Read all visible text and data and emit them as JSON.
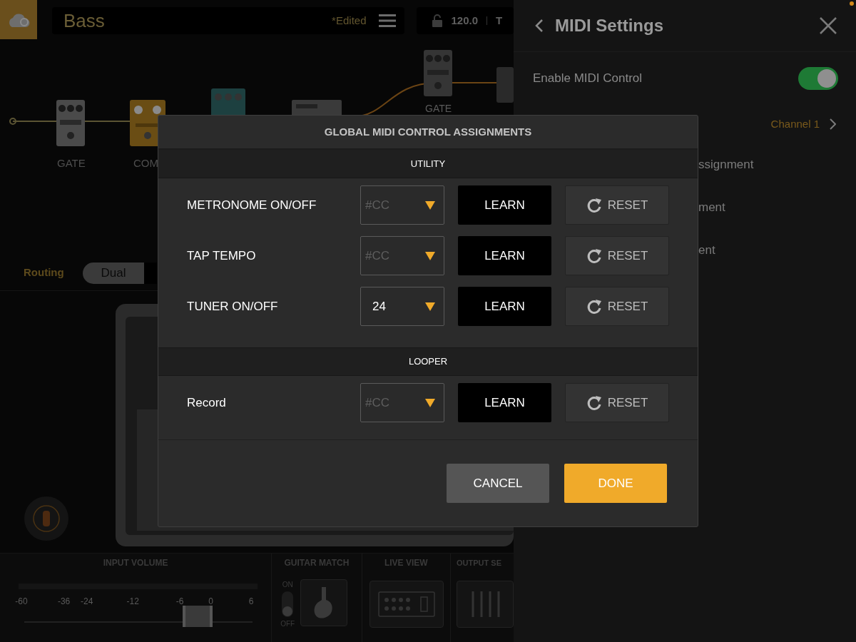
{
  "top_bar": {
    "preset_name": "Bass",
    "edited": "*Edited",
    "tempo": "120.0",
    "tap": "T"
  },
  "chain": [
    {
      "label": "GATE"
    },
    {
      "label": "COM"
    }
  ],
  "upper_chain": [
    {
      "label": "GATE"
    }
  ],
  "routing": {
    "label": "Routing",
    "option": "Dual"
  },
  "bottom": {
    "input_volume": {
      "title": "INPUT VOLUME",
      "ticks": [
        "-60",
        "-36",
        "-24",
        "-12",
        "-6",
        "0",
        "6"
      ],
      "level": 0.76
    },
    "guitar_match": {
      "title": "GUITAR MATCH",
      "on_label": "ON",
      "off_label": "OFF",
      "on": false
    },
    "live_view": {
      "title": "LIVE VIEW"
    },
    "output": {
      "title": "OUTPUT SE"
    }
  },
  "midi_panel": {
    "title": "MIDI Settings",
    "enable_label": "Enable MIDI Control",
    "enabled": true,
    "channel": "Channel 1",
    "items": [
      "ssignment",
      "ment",
      "ent"
    ]
  },
  "dialog": {
    "title": "GLOBAL MIDI CONTROL ASSIGNMENTS",
    "sections": [
      {
        "title": "UTILITY",
        "rows": [
          {
            "label": "METRONOME ON/OFF",
            "placeholder": "#CC",
            "learn": "LEARN",
            "reset": "RESET"
          },
          {
            "label": "TAP TEMPO",
            "placeholder": "#CC",
            "learn": "LEARN",
            "reset": "RESET"
          },
          {
            "label": "TUNER ON/OFF",
            "value": "24",
            "learn": "LEARN",
            "reset": "RESET"
          }
        ]
      },
      {
        "title": "LOOPER",
        "rows": [
          {
            "label": "Record",
            "placeholder": "#CC",
            "learn": "LEARN",
            "reset": "RESET"
          }
        ]
      }
    ],
    "cancel": "CANCEL",
    "done": "DONE"
  }
}
